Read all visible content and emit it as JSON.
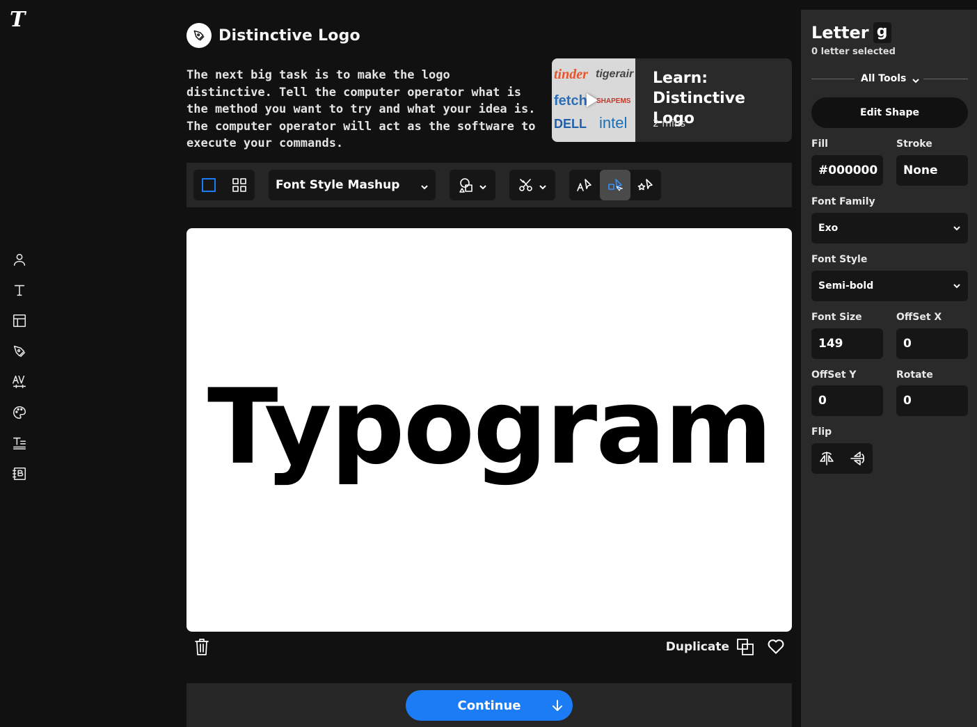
{
  "app": {
    "logo_glyph": "T"
  },
  "rail": {
    "items": [
      {
        "name": "user-icon"
      },
      {
        "name": "text-icon"
      },
      {
        "name": "layout-icon"
      },
      {
        "name": "pen-tool-icon"
      },
      {
        "name": "kerning-icon"
      },
      {
        "name": "palette-icon"
      },
      {
        "name": "text-lines-icon"
      },
      {
        "name": "brand-book-icon"
      }
    ]
  },
  "main": {
    "title": "Distinctive Logo",
    "intro": "The next big task is to make the logo distinctive. Tell the computer operator what is the method you want to try and what your idea is. The computer operator will act as the software to execute your commands.",
    "learn": {
      "title": "Learn: Distinctive Logo",
      "duration": "2 mins",
      "thumb_logos": [
        "tinder",
        "tigerair",
        "fetch",
        "SHAPEMS",
        "DELL",
        "intel"
      ]
    },
    "toolbar": {
      "style_select": "Font Style Mashup",
      "active_tool": "select-cursor-tool"
    },
    "canvas_text": "Typogram",
    "duplicate_label": "Duplicate",
    "continue_label": "Continue"
  },
  "panel": {
    "title": "Letter",
    "letter": "g",
    "subtitle": "0 letter selected",
    "all_tools": "All Tools",
    "edit_shape": "Edit Shape",
    "fill_label": "Fill",
    "fill_value": "#000000",
    "stroke_label": "Stroke",
    "stroke_value": "None",
    "font_family_label": "Font Family",
    "font_family_value": "Exo",
    "font_style_label": "Font Style",
    "font_style_value": "Semi-bold",
    "font_size_label": "Font Size",
    "font_size_value": "149",
    "offset_x_label": "OffSet X",
    "offset_x_value": "0",
    "offset_y_label": "OffSet Y",
    "offset_y_value": "0",
    "rotate_label": "Rotate",
    "rotate_value": "0",
    "flip_label": "Flip"
  },
  "colors": {
    "background": "#111111",
    "panel": "#2a2a2a",
    "accent": "#1b7cf5",
    "canvas": "#ffffff"
  }
}
